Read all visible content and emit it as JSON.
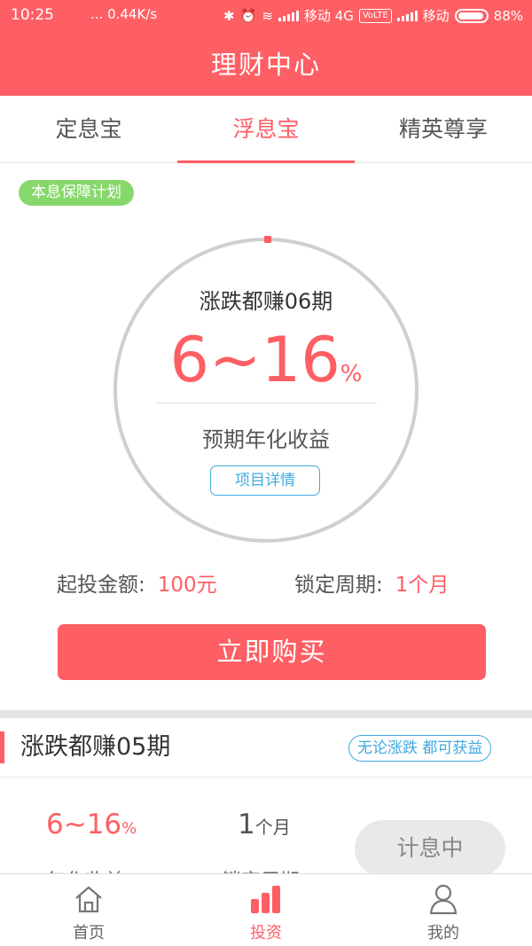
{
  "status_bar": {
    "time": "10:25",
    "net_speed": "... 0.44K/s",
    "carrier1": "移动 4G",
    "volte": "VoLTE",
    "carrier2": "移动",
    "battery": "88%"
  },
  "header": {
    "title": "理财中心"
  },
  "tabs": [
    {
      "label": "定息宝",
      "active": false
    },
    {
      "label": "浮息宝",
      "active": true
    },
    {
      "label": "精英尊享",
      "active": false
    }
  ],
  "featured": {
    "badge": "本息保障计划",
    "name": "涨跌都赚06期",
    "rate_value": "6~16",
    "rate_unit": "%",
    "rate_label": "预期年化收益",
    "detail_button": "项目详情",
    "min_amount_label": "起投金额:",
    "min_amount_value": "100元",
    "lock_period_label": "锁定周期:",
    "lock_period_value": "1个月",
    "buy_button": "立即购买"
  },
  "second_product": {
    "name": "涨跌都赚05期",
    "tag": "无论涨跌 都可获益",
    "rate_value": "6~16",
    "rate_unit": "%",
    "rate_label": "年化收益",
    "period_value": "1",
    "period_unit": "个月",
    "period_label": "锁定周期",
    "status_button": "计息中"
  },
  "nav": [
    {
      "label": "首页",
      "icon": "home-icon",
      "active": false
    },
    {
      "label": "投资",
      "icon": "investment-chart-icon",
      "active": true
    },
    {
      "label": "我的",
      "icon": "user-icon",
      "active": false
    }
  ],
  "colors": {
    "accent": "#fe5f64",
    "badge_green": "#86d86a",
    "link_blue": "#3fa9df"
  }
}
